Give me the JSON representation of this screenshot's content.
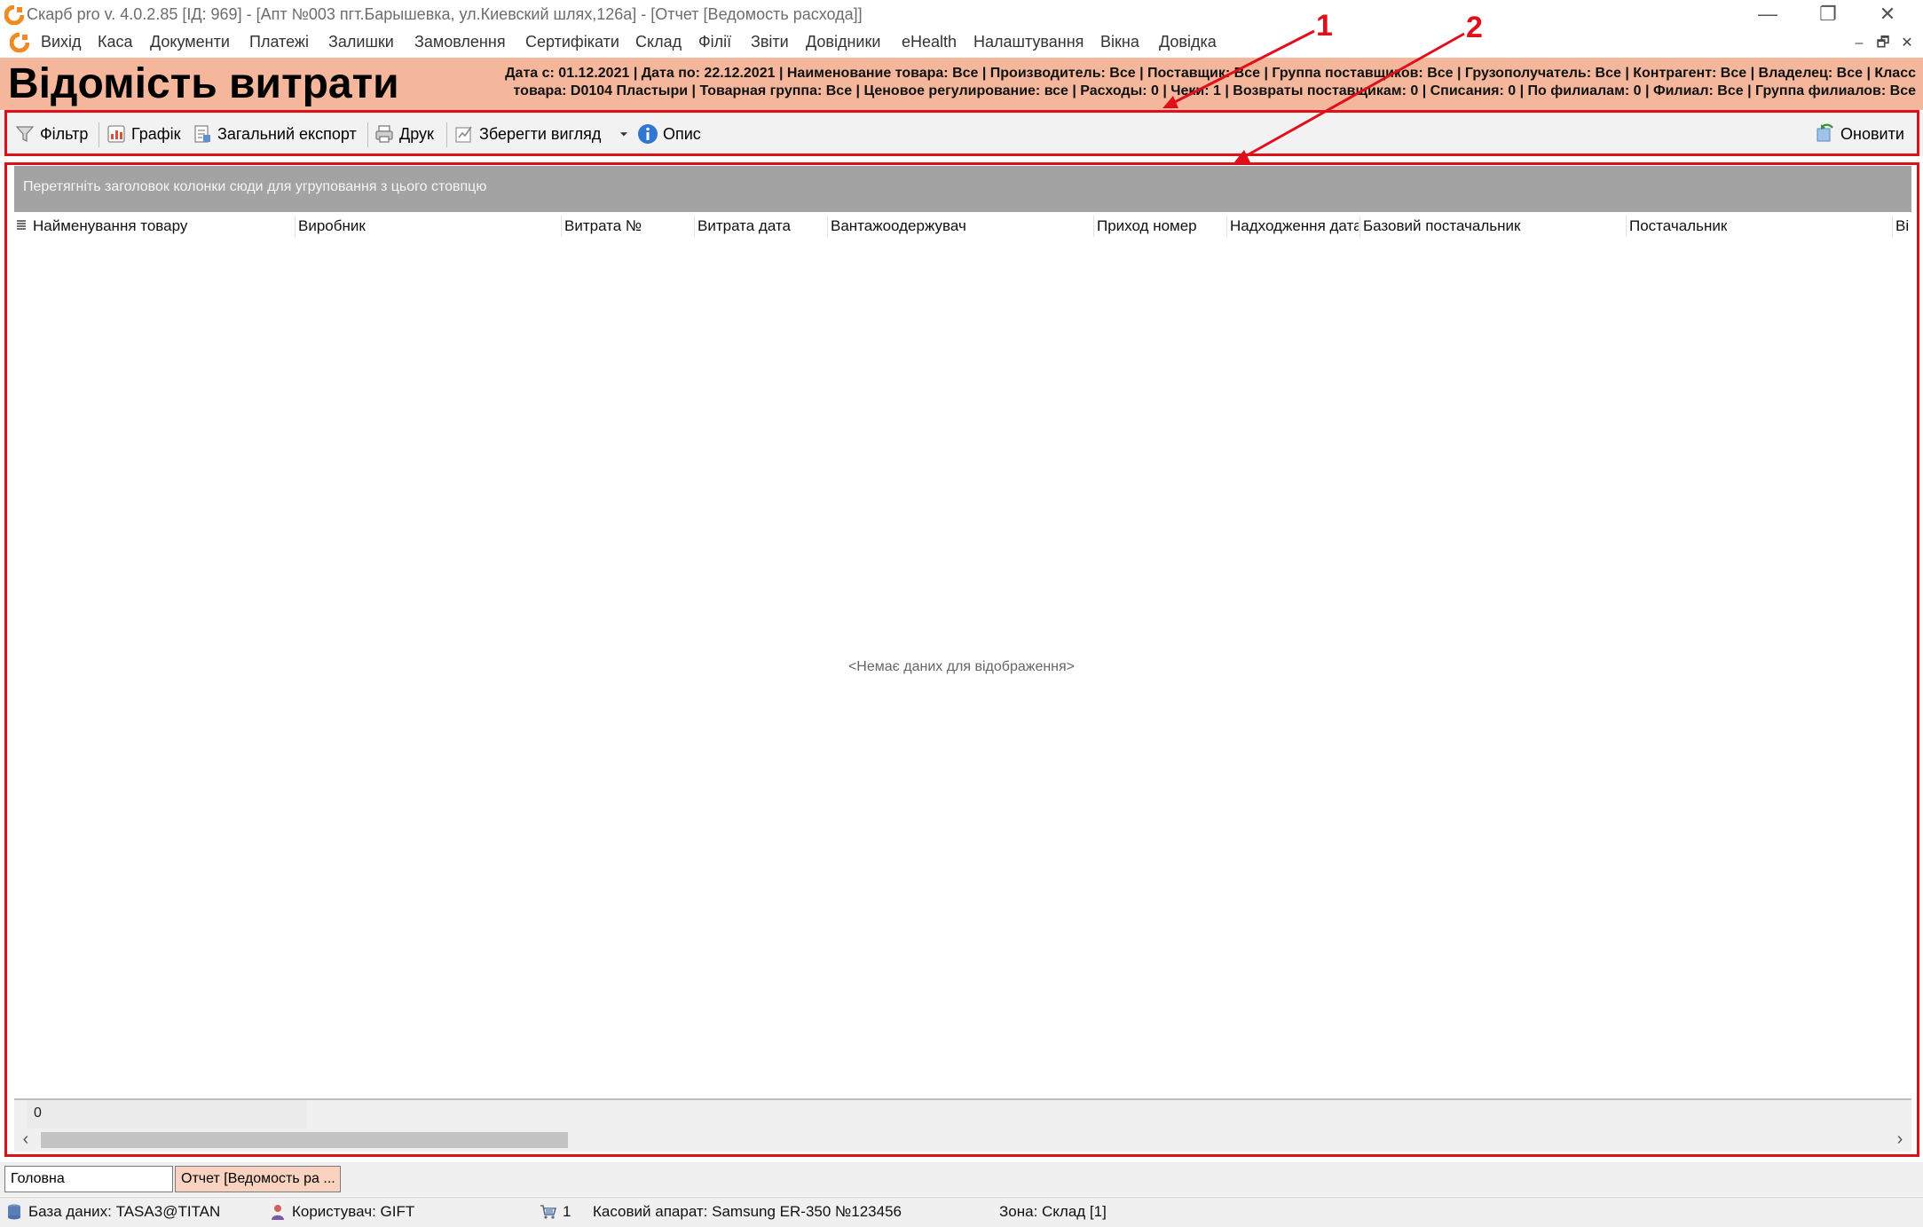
{
  "window": {
    "title": "Скарб pro v. 4.0.2.85 [ІД: 969] - [Апт №003 пгт.Барышевка, ул.Киевский шлях,126а] - [Отчет [Ведомость расхода]]",
    "minimize": "—",
    "restore": "❐",
    "close": "✕"
  },
  "menu": {
    "items": [
      "Вихід",
      "Каса",
      "Документи",
      "Платежі",
      "Залишки",
      "Замовлення",
      "Сертифікати",
      "Склад",
      "Філії",
      "Звіти",
      "Довідники",
      "eHealth",
      "Налаштування",
      "Вікна",
      "Довідка"
    ],
    "mdi_minimize": "–",
    "mdi_restore": "🗗",
    "mdi_close": "✕"
  },
  "report": {
    "title": "Відомість витрати",
    "filters_line1": "Дата с: 01.12.2021 | Дата по: 22.12.2021 | Наименование товара: Все | Производитель: Все | Поставщик: Все | Группа поставщиков: Все | Грузополучатель: Все | Контрагент: Все | Владелец: Все | Класс",
    "filters_line2": "товара: D0104  Пластыри | Товарная группа: Все | Ценовое регулирование: все | Расходы: 0 | Чеки: 1 | Возвраты поставщикам: 0 | Списания: 0 | По филиалам: 0 | Филиал: Все | Группа филиалов: Все"
  },
  "toolbar": {
    "filter": "Фільтр",
    "chart": "Графік",
    "export": "Загальний експорт",
    "print": "Друк",
    "save_view": "Зберегти вигляд",
    "description": "Опис",
    "refresh": "Оновити"
  },
  "annotations": {
    "label_1": "1",
    "label_2": "2"
  },
  "grid": {
    "group_hint": "Перетягніть заголовок колонки сюди для угруповання з цього стовпцю",
    "columns": [
      "Найменування товару",
      "Виробник",
      "Витрата №",
      "Витрата дата",
      "Вантажоодержувач",
      "Приход номер",
      "Надходження дата",
      "Базовий постачальник",
      "Постачальник",
      "Ві"
    ],
    "no_data": "<Немає даних для відображення>",
    "footer_count": "0"
  },
  "doc_tabs": {
    "home": "Головна",
    "report": "Отчет [Ведомость ра ..."
  },
  "status": {
    "database": "База даних: TASA3@TITAN",
    "user": "Користувач: GIFT",
    "count": "1",
    "cash_register": "Касовий апарат: Samsung ER-350 №123456",
    "zone": "Зона: Склад [1]"
  },
  "colors": {
    "header_bg": "#f4b79c",
    "annotation_red": "#e0101a",
    "group_panel": "#a3a3a3",
    "active_tab": "#f9d3bf"
  }
}
